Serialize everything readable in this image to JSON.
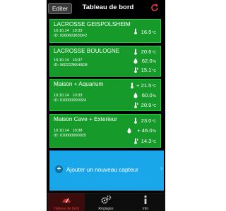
{
  "navbar": {
    "edit_label": "Editer",
    "title": "Tableau de bord"
  },
  "sensors": [
    {
      "name": "LACROSSE GEISPOLSHEIM",
      "date": "10.10.14",
      "time": "10:33",
      "id": "ID: 020060363DF2",
      "temperature": "16.5",
      "temperature_unit": "°C"
    },
    {
      "name": "LACROSSE BOULOGNE",
      "date": "10.10.14",
      "time": "10:37",
      "id": "ID: 060222B549EB",
      "temperature": "20.6",
      "temperature_unit": "°C",
      "humidity": "62.0",
      "humidity_unit": "%",
      "dew": "15.1",
      "dew_unit": "°C"
    },
    {
      "name": "Maison + Aquarium",
      "date": "10.10.14",
      "time": "10:33",
      "id": "ID: 010000000024",
      "temperature": "21.5",
      "temperature_unit": "°C",
      "temperature_trend": "+",
      "humidity": "60.0",
      "humidity_unit": "%",
      "dew": "20.9",
      "dew_unit": "°C"
    },
    {
      "name": "Maison Cave + Exterieur",
      "date": "10.10.14",
      "time": "10:38",
      "id": "ID: 010000000025",
      "temperature": "23.0",
      "temperature_unit": "°C",
      "humidity": "46.0",
      "humidity_unit": "%",
      "humidity_trend": "+",
      "dew": "14.3",
      "dew_unit": "°C"
    }
  ],
  "add_sensor": {
    "label": "Ajouter un nouveau capteur",
    "chevron": "›"
  },
  "tabs": [
    {
      "label": "Tableau de bord",
      "icon": "gauge-icon",
      "active": true
    },
    {
      "label": "Réglages",
      "icon": "gears-icon",
      "active": false
    },
    {
      "label": "Info",
      "icon": "info-icon",
      "active": false
    }
  ],
  "colors": {
    "card_green": "#169a2a",
    "add_blue": "#1aa7ea",
    "active_tab_red": "#e23a3a",
    "refresh_red": "#e23a3a"
  }
}
